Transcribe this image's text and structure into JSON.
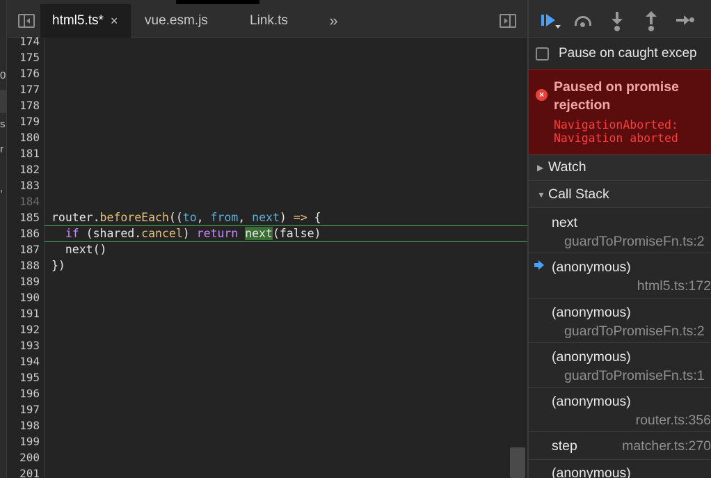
{
  "left_fragments": [
    "0",
    "s",
    "r",
    ","
  ],
  "tabs": {
    "items": [
      {
        "label": "html5.ts*",
        "close": "×"
      },
      {
        "label": "vue.esm.js"
      },
      {
        "label": "Link.ts"
      }
    ],
    "more": "»"
  },
  "editor": {
    "line_numbers": [
      "174",
      "175",
      "176",
      "177",
      "178",
      "179",
      "180",
      "181",
      "182",
      "183",
      "184",
      "185",
      "186",
      "187",
      "188",
      "189",
      "190",
      "191",
      "192",
      "193",
      "194",
      "195",
      "196",
      "197",
      "198",
      "199",
      "200",
      "201"
    ],
    "code": {
      "l185": {
        "a": "router.",
        "b": "beforeEach",
        "c": "((",
        "d": "to",
        "e": ", ",
        "f": "from",
        "g": ", ",
        "h": "next",
        "i": ") ",
        "j": "=>",
        "k": " {"
      },
      "l186": {
        "a": "  ",
        "b": "if",
        "c": " (shared.",
        "d": "cancel",
        "e": ") ",
        "f": "return",
        "g": " ",
        "h": "next",
        "i": "(false)"
      },
      "l187": "  next()",
      "l188": "})"
    }
  },
  "debugger": {
    "pause_on_caught_label": "Pause on caught excep",
    "pause_reason": "Paused on promise rejection",
    "error_text": "NavigationAborted:\nNavigation aborted",
    "watch_label": "Watch",
    "call_stack_label": "Call Stack",
    "call_stack": [
      {
        "name": "next",
        "location": "guardToPromiseFn.ts:2"
      },
      {
        "name": "(anonymous)",
        "location": "html5.ts:172"
      },
      {
        "name": "(anonymous)",
        "location": "guardToPromiseFn.ts:2"
      },
      {
        "name": "(anonymous)",
        "location": "guardToPromiseFn.ts:1"
      },
      {
        "name": "(anonymous)",
        "location": "router.ts:356"
      },
      {
        "name": "step",
        "location": "matcher.ts:270"
      },
      {
        "name": "(anonymous)",
        "location": ""
      }
    ]
  },
  "colors": {
    "keyword": "#c58af9",
    "function": "#e5c276",
    "param": "#5db0d7",
    "exec_line": "#3fae57",
    "error_bg": "#5b0d0d",
    "error_text": "#ff3c3c",
    "accent": "#4d9ef6"
  }
}
